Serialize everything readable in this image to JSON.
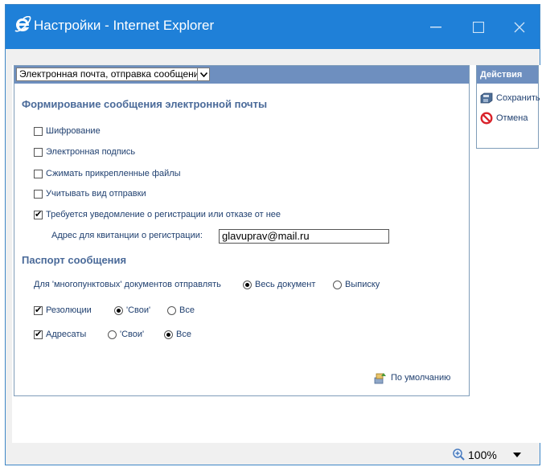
{
  "window": {
    "title": "Настройки - Internet Explorer"
  },
  "form": {
    "format_select": "Электронная почта, отправка сообщений",
    "section1_title": "Формирование сообщения электронной почты",
    "encryption": {
      "label": "Шифрование",
      "checked": false
    },
    "signature": {
      "label": "Электронная подпись",
      "checked": false
    },
    "compress": {
      "label": "Сжимать прикрепленные файлы",
      "checked": false
    },
    "delivery_type": {
      "label": "Учитывать вид отправки",
      "checked": false
    },
    "notify": {
      "label": "Требуется уведомление о регистрации или отказе от нее",
      "checked": true
    },
    "receipt_label": "Адрес для квитанции о регистрации:",
    "receipt_value": "glavuprav@mail.ru",
    "section2_title": "Паспорт сообщения",
    "multipoint_label": "Для 'многопунктовых' документов отправлять",
    "multipoint_options": [
      "Весь документ",
      "Выписку"
    ],
    "multipoint_selected": "Весь документ",
    "resolutions": {
      "label": "Резолюции",
      "checked": true,
      "options": [
        "'Свои'",
        "Все"
      ],
      "selected": "'Свои'"
    },
    "addressees": {
      "label": "Адресаты",
      "checked": true,
      "options": [
        "'Свои'",
        "Все"
      ],
      "selected": "Все"
    },
    "default_link": "По умолчанию"
  },
  "actions": {
    "title": "Действия",
    "save": "Сохранить",
    "cancel": "Отмена"
  },
  "statusbar": {
    "zoom": "100%"
  },
  "icons": {
    "ie": "ie-logo-icon",
    "minimize": "minimize-icon",
    "maximize": "maximize-icon",
    "close": "close-icon",
    "save": "floppy-disk-icon",
    "cancel": "forbidden-icon",
    "default": "reset-defaults-icon",
    "zoom": "zoom-in-icon",
    "dropdown": "chevron-down-icon"
  },
  "colors": {
    "titlebar": "#1f80d8",
    "panel_header": "#6e8fbf",
    "heading": "#4a6a99"
  }
}
